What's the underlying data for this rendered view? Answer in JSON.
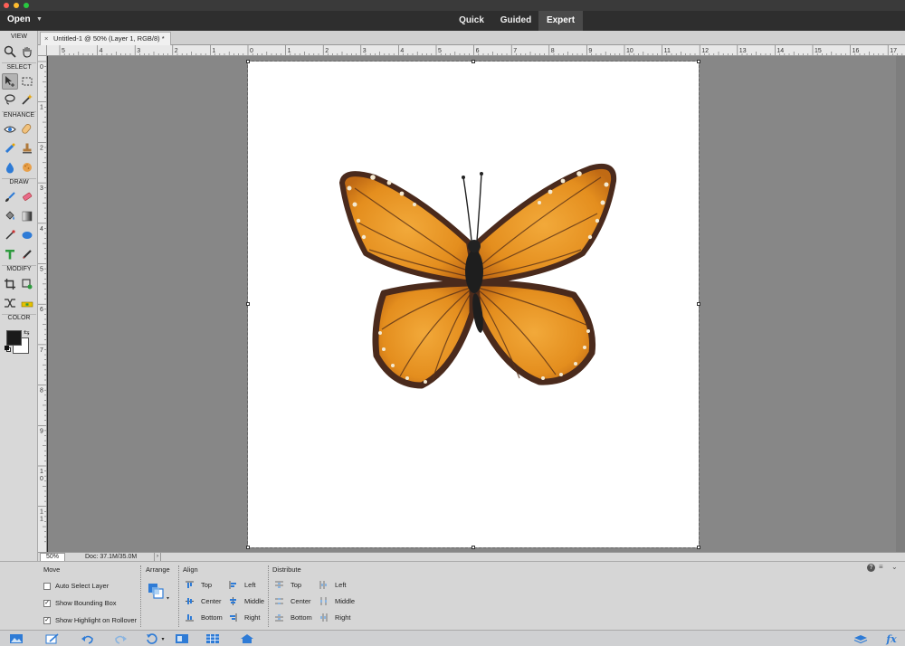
{
  "modes": {
    "open_label": "Open",
    "tabs": [
      {
        "label": "Quick"
      },
      {
        "label": "Guided"
      },
      {
        "label": "Expert"
      }
    ]
  },
  "document_tab": {
    "close_glyph": "×",
    "title": "Untitled-1 @ 50% (Layer 1, RGB/8) *"
  },
  "toolbox": {
    "sections": {
      "view": "VIEW",
      "select": "SELECT",
      "enhance": "ENHANCE",
      "draw": "DRAW",
      "modify": "MODIFY",
      "color": "COLOR"
    },
    "foreground_color": "#1a1a1a",
    "background_color": "#ffffff"
  },
  "rulers": {
    "horizontal_labels": [
      "5",
      "4",
      "3",
      "2",
      "1",
      "0",
      "1",
      "2",
      "3",
      "4",
      "5",
      "6",
      "7",
      "8",
      "9",
      "10",
      "11",
      "12",
      "13",
      "14",
      "15",
      "16",
      "17"
    ],
    "vertical_labels": [
      "0",
      "1",
      "2",
      "3",
      "4",
      "5",
      "6",
      "7",
      "8",
      "9",
      "1 0",
      "1 1"
    ]
  },
  "status": {
    "zoom": "50%",
    "doc_info": "Doc: 37.1M/35.0M"
  },
  "options": {
    "move": {
      "title": "Move",
      "auto_select": "Auto Select Layer",
      "auto_select_checked": false,
      "show_bbox": "Show Bounding Box",
      "show_bbox_checked": true,
      "show_highlight": "Show Highlight on Rollover",
      "show_highlight_checked": true
    },
    "arrange": {
      "title": "Arrange"
    },
    "align": {
      "title": "Align",
      "top": "Top",
      "center": "Center",
      "bottom": "Bottom",
      "left": "Left",
      "middle": "Middle",
      "right": "Right"
    },
    "distribute": {
      "title": "Distribute",
      "top": "Top",
      "center": "Center",
      "bottom": "Bottom",
      "left": "Left",
      "middle": "Middle",
      "right": "Right"
    }
  },
  "colors": {
    "butterfly_orange": "#e8941f",
    "butterfly_dark": "#4a2a1c",
    "accent_blue": "#2e7bd6"
  }
}
